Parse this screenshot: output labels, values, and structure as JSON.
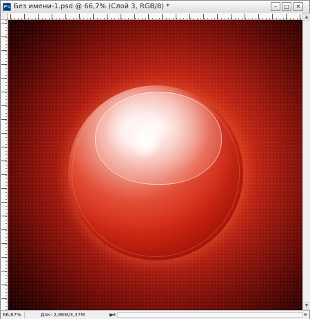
{
  "window": {
    "title": "Без имени-1.psd @ 66,7% (Слой 3, RGB/8) *",
    "app_icon_text": "Ps",
    "controls": {
      "minimize": "–",
      "maximize": "□",
      "close": "✕"
    }
  },
  "status": {
    "zoom": "66,67%",
    "document": "Док: 2,86M/3,37M",
    "arrow": "▶"
  },
  "scrollbar": {
    "up": "▲",
    "down": "▼",
    "left": "◀",
    "right": "▶"
  },
  "colors": {
    "canvas_red": "#d8331a",
    "deep_red": "#430404",
    "sphere_red": "#cf2714",
    "highlight": "#ffffff"
  },
  "icons": {
    "app": "photoshop-icon",
    "minimize": "minimize-icon",
    "maximize": "maximize-icon",
    "close": "close-icon"
  }
}
